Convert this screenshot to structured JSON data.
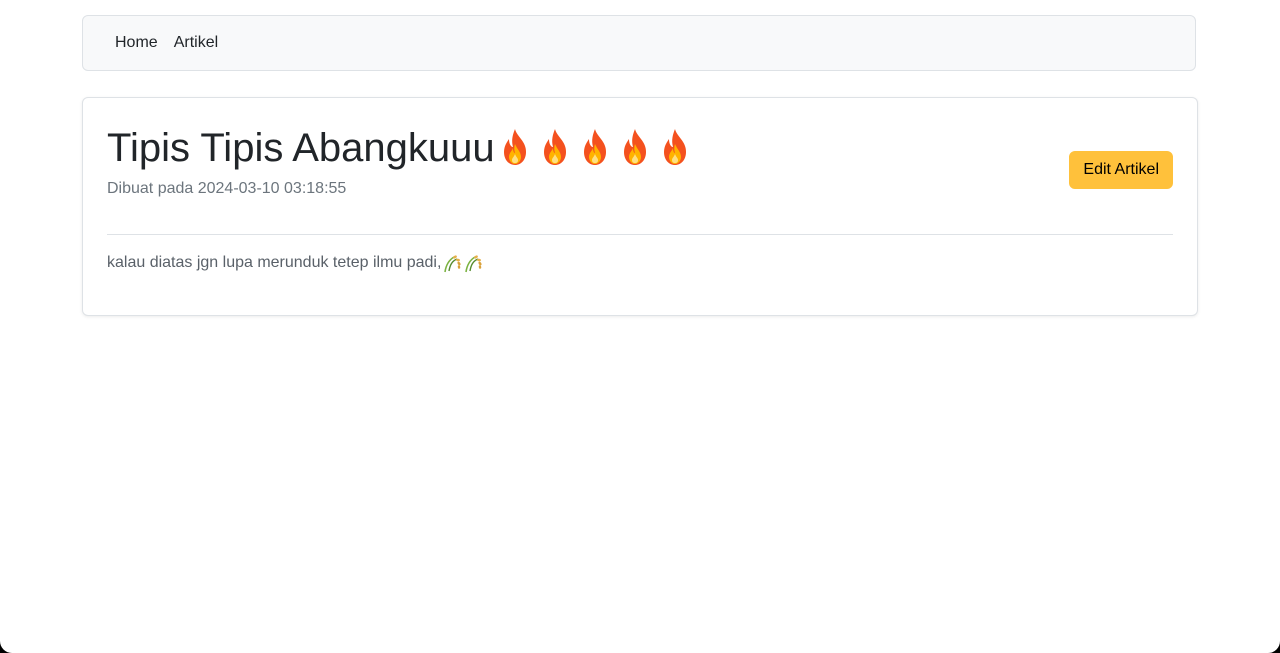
{
  "navbar": {
    "items": [
      {
        "label": "Home"
      },
      {
        "label": "Artikel"
      }
    ]
  },
  "article": {
    "title": "Tipis Tipis Abangkuuu",
    "title_emoji": [
      "fire-icon",
      "fire-icon",
      "fire-icon",
      "fire-icon",
      "fire-icon"
    ],
    "meta": "Dibuat pada 2024-03-10 03:18:55",
    "edit_label": "Edit Artikel",
    "body": "kalau diatas jgn lupa merunduk tetep ilmu padi,",
    "body_emoji": [
      "rice-icon",
      "rice-icon"
    ]
  },
  "colors": {
    "edit_button": "#ffc13b",
    "navbar_bg": "#f8f9fa",
    "muted_text": "#6c757d"
  }
}
